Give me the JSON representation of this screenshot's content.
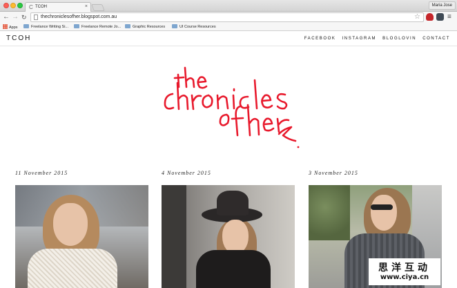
{
  "browser": {
    "tab_title": "TCOH",
    "profile_name": "Maria Jose",
    "url": "thechroniclesofher.blogspot.com.au"
  },
  "bookmarks": {
    "items": [
      {
        "label": "Apps",
        "icon": "apps-grid-icon"
      },
      {
        "label": "Freelance Writing Si...",
        "icon": "folder-icon"
      },
      {
        "label": "Freelance Remote Jo...",
        "icon": "folder-icon"
      },
      {
        "label": "Graphic Resources",
        "icon": "folder-icon"
      },
      {
        "label": "UI Course Resources",
        "icon": "folder-icon"
      }
    ]
  },
  "site": {
    "brand": "TCOH",
    "nav": [
      "FACEBOOK",
      "INSTAGRAM",
      "BLOGLOVIN",
      "CONTACT"
    ],
    "logo_text": "the chronicles of her",
    "accent_color": "#e8192c"
  },
  "posts": [
    {
      "date": "11 November 2015"
    },
    {
      "date": "4 November 2015"
    },
    {
      "date": "3 November 2015"
    }
  ],
  "watermark": {
    "chinese": "思洋互动",
    "url": "www.ciya.cn"
  }
}
